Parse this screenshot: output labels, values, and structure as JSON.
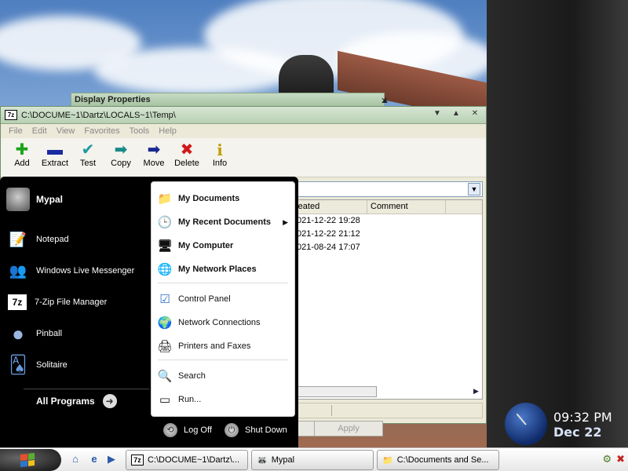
{
  "display_properties": {
    "title": "Display Properties",
    "minimize": "▲",
    "close": "✕",
    "apply_label": "Apply"
  },
  "zip_window": {
    "app_icon": "7z",
    "title": "C:\\DOCUME~1\\Dartz\\LOCALS~1\\Temp\\",
    "window_buttons": {
      "minimize": "▼",
      "restore": "▲",
      "close": "✕"
    },
    "menu": [
      "File",
      "Edit",
      "View",
      "Favorites",
      "Tools",
      "Help"
    ],
    "toolbar": [
      {
        "label": "Add",
        "icon": "plus-icon",
        "glyph": "✚",
        "color": "#1aa31a"
      },
      {
        "label": "Extract",
        "icon": "minus-icon",
        "glyph": "▬",
        "color": "#1a2aa0"
      },
      {
        "label": "Test",
        "icon": "check-icon",
        "glyph": "✔",
        "color": "#1a9aa0"
      },
      {
        "label": "Copy",
        "icon": "copy-arrow-icon",
        "glyph": "➡",
        "color": "#1a8a8a"
      },
      {
        "label": "Move",
        "icon": "move-arrow-icon",
        "glyph": "➡",
        "color": "#1a2a90"
      },
      {
        "label": "Delete",
        "icon": "delete-x-icon",
        "glyph": "✖",
        "color": "#d01a1a"
      },
      {
        "label": "Info",
        "icon": "info-icon",
        "glyph": "i",
        "color": "#c0a000"
      }
    ],
    "address_dropdown": "▼",
    "columns": [
      "reated",
      "Comment"
    ],
    "rows": [
      {
        "created": "021-12-22 19:28"
      },
      {
        "created": "021-12-22 21:12"
      },
      {
        "created": "021-08-24 17:07"
      }
    ],
    "scroll_right": "▶"
  },
  "start_menu": {
    "user_name": "Mypal",
    "pinned": [
      {
        "label": "Notepad",
        "icon": "notepad-icon",
        "glyph": "📝"
      },
      {
        "label": "Windows Live Messenger",
        "icon": "messenger-icon",
        "glyph": "👥"
      },
      {
        "label": "7-Zip File Manager",
        "icon": "7zip-icon",
        "glyph": "7z"
      },
      {
        "label": "Pinball",
        "icon": "pinball-icon",
        "glyph": "●"
      },
      {
        "label": "Solitaire",
        "icon": "solitaire-icon",
        "glyph": "🂡"
      }
    ],
    "all_programs": "All Programs",
    "all_programs_arrow": "➜",
    "right": [
      {
        "label": "My Documents",
        "icon": "folder-icon",
        "glyph": "📁",
        "bold": true
      },
      {
        "label": "My Recent Documents",
        "icon": "recent-docs-icon",
        "glyph": "🕒",
        "bold": true,
        "submenu": "▶"
      },
      {
        "label": "My Computer",
        "icon": "computer-icon",
        "glyph": "🖥",
        "bold": true
      },
      {
        "label": "My Network Places",
        "icon": "network-places-icon",
        "glyph": "🌐",
        "bold": true
      },
      {
        "label": "Control Panel",
        "icon": "control-panel-icon",
        "glyph": "☑",
        "bold": false
      },
      {
        "label": "Network Connections",
        "icon": "network-connections-icon",
        "glyph": "🌍",
        "bold": false
      },
      {
        "label": "Printers and Faxes",
        "icon": "printer-icon",
        "glyph": "🖨",
        "bold": false
      },
      {
        "label": "Search",
        "icon": "search-icon",
        "glyph": "🔍",
        "bold": false
      },
      {
        "label": "Run...",
        "icon": "run-icon",
        "glyph": "▭",
        "bold": false
      }
    ],
    "log_off": "Log Off",
    "shut_down": "Shut Down"
  },
  "clock": {
    "time": "09:32 PM",
    "date": "Dec 22"
  },
  "taskbar": {
    "tasks": [
      {
        "label": "C:\\DOCUME~1\\Dartz\\...",
        "icon": "7z"
      },
      {
        "label": "Mypal",
        "icon": "🦝"
      },
      {
        "label": "C:\\Documents and Se...",
        "icon": "📁"
      }
    ],
    "quick_launch": [
      "⌂",
      "e",
      "▶"
    ],
    "tray": [
      "⚙",
      "✖"
    ]
  }
}
